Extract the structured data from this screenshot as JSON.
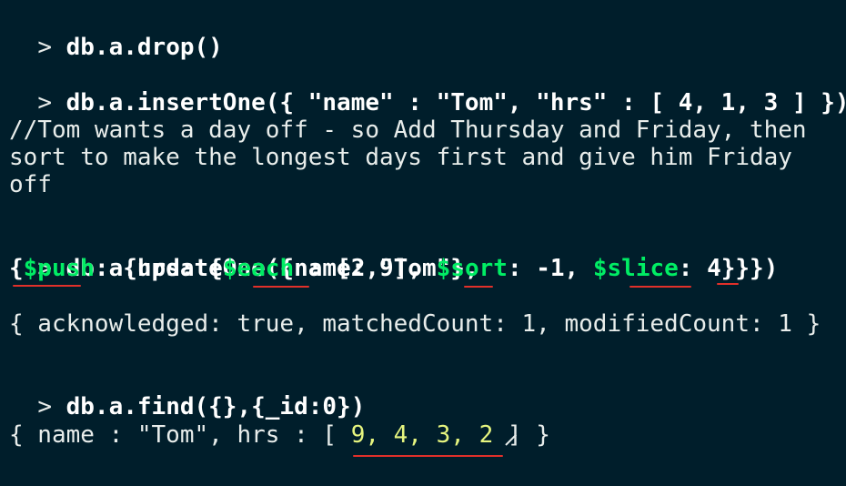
{
  "prompt": ">",
  "commands": {
    "drop": "db.a.drop()",
    "insert": "db.a.insertOne({ \"name\" : \"Tom\", \"hrs\" : [ 4, 1, 3 ] })",
    "update_line1": "db.a.updateOne({name: \"Tom\"},",
    "update_line2": {
      "p1": "{",
      "push": "$push",
      "p2": ": {hrs: {",
      "each": "$each",
      "p3": " : [2,9], ",
      "sort": "$sort",
      "p4": ": -1, ",
      "slice": "$slice",
      "p5": ": 4}}})"
    },
    "find": "db.a.find({},{_id:0})"
  },
  "comment_lines": [
    "//Tom wants a day off - so Add Thursday and Friday, then",
    "sort to make the longest days first and give him Friday",
    "off"
  ],
  "update_result": "{ acknowledged: true, matchedCount: 1, modifiedCount: 1 }",
  "find_result": {
    "prefix": "{ name : \"Tom\", hrs : [ ",
    "values": "9, 4, 3, 2",
    "suffix": " ] }"
  },
  "colors": {
    "background": "#001e2b",
    "operator": "#00ed64",
    "annotation": "#e0302a",
    "number": "#e6f57f"
  }
}
